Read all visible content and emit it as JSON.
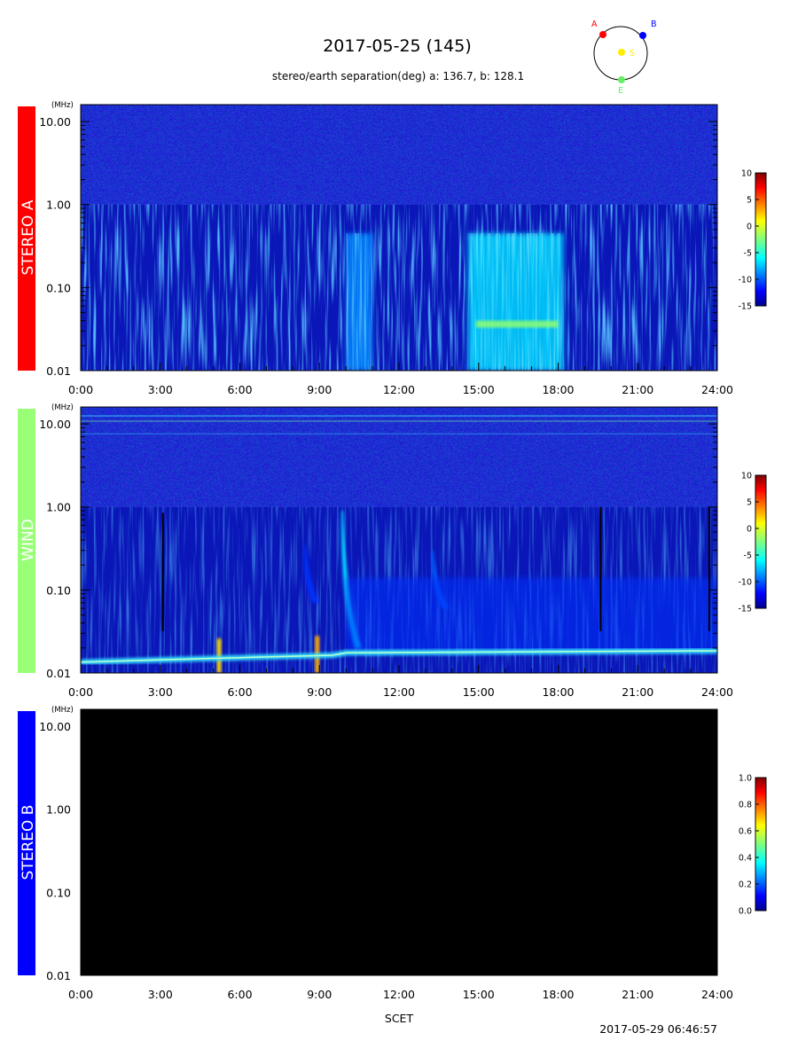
{
  "title": "2017-05-25 (145)",
  "subtitle": "stereo/earth separation(deg) a: 136.7, b: 128.1",
  "footer_xlabel": "SCET",
  "footer_timestamp": "2017-05-29 06:46:57",
  "orbit": {
    "labels": {
      "a": "A",
      "b": "B",
      "s": "S",
      "e": "E"
    },
    "colors": {
      "a": "#ff0000",
      "b": "#0000ff",
      "s": "#ffee00",
      "e": "#66ee66",
      "ring": "#000000"
    }
  },
  "chart_data": [
    {
      "type": "heatmap",
      "panel": "STEREO A",
      "side_label": "STEREO A",
      "side_color": "#ff0000",
      "unit_label": "(MHz)",
      "y_scale": "log",
      "ylim": [
        0.01,
        16
      ],
      "yticks": [
        {
          "value": 10,
          "label": "10.00"
        },
        {
          "value": 1,
          "label": "1.00"
        },
        {
          "value": 0.1,
          "label": "0.10"
        },
        {
          "value": 0.01,
          "label": "0.01"
        }
      ],
      "xlim": [
        0,
        24
      ],
      "xticks": [
        "0:00",
        "3:00",
        "6:00",
        "9:00",
        "12:00",
        "15:00",
        "18:00",
        "21:00",
        "24:00"
      ],
      "colorbar": {
        "min": -15,
        "max": 10,
        "ticks": [
          "10",
          "5",
          "0",
          "-5",
          "-10",
          "-15"
        ],
        "colormap": "jet"
      },
      "background": "dark-blue noise (low-frequency band 0.01-1 MHz, high-frequency band 1-16 MHz)",
      "features": [
        {
          "kind": "enhancement",
          "t_start": 10.0,
          "t_end": 11.0,
          "f_low": 0.01,
          "f_high": 0.45,
          "level": -9
        },
        {
          "kind": "enhancement",
          "t_start": 14.6,
          "t_end": 18.2,
          "f_low": 0.01,
          "f_high": 0.45,
          "level": -7
        },
        {
          "kind": "band",
          "t_start": 14.9,
          "t_end": 18.0,
          "f_low": 0.033,
          "f_high": 0.04,
          "level": -2
        }
      ]
    },
    {
      "type": "heatmap",
      "panel": "WIND",
      "side_label": "WIND",
      "side_color": "#99ff77",
      "unit_label": "(MHz)",
      "y_scale": "log",
      "ylim": [
        0.01,
        16
      ],
      "yticks": [
        {
          "value": 10,
          "label": "10.00"
        },
        {
          "value": 1,
          "label": "1.00"
        },
        {
          "value": 0.1,
          "label": "0.10"
        },
        {
          "value": 0.01,
          "label": "0.01"
        }
      ],
      "xlim": [
        0,
        24
      ],
      "xticks": [
        "0:00",
        "3:00",
        "6:00",
        "9:00",
        "12:00",
        "15:00",
        "18:00",
        "21:00",
        "24:00"
      ],
      "colorbar": {
        "min": -15,
        "max": 10,
        "ticks": [
          "10",
          "5",
          "0",
          "-5",
          "-10",
          "-15"
        ],
        "colormap": "jet"
      },
      "background": "dark-blue noise; plasma line near 0.014-0.018 MHz",
      "features": [
        {
          "kind": "type-III burst",
          "t_start": 9.9,
          "t_end": 10.6,
          "f_low": 0.02,
          "f_high": 0.9,
          "level": -7
        },
        {
          "kind": "type-III burst",
          "t_start": 13.3,
          "t_end": 13.9,
          "f_low": 0.06,
          "f_high": 0.3,
          "level": -10
        },
        {
          "kind": "type-III burst",
          "t_start": 8.5,
          "t_end": 9.0,
          "f_low": 0.07,
          "f_high": 0.35,
          "level": -11
        },
        {
          "kind": "diffuse emission",
          "t_start": 10.0,
          "t_end": 24.0,
          "f_low": 0.018,
          "f_high": 0.14,
          "level": -11
        },
        {
          "kind": "data gap",
          "t": 3.1,
          "f_low": 0.032,
          "f_high": 0.85
        },
        {
          "kind": "data gap",
          "t": 19.6,
          "f_low": 0.032,
          "f_high": 1.0
        },
        {
          "kind": "data gap",
          "t": 23.7,
          "f_low": 0.032,
          "f_high": 1.0
        },
        {
          "kind": "spike",
          "t": 5.2,
          "f_low": 0.01,
          "f_high": 0.026,
          "level": 2
        },
        {
          "kind": "spike",
          "t": 8.9,
          "f_low": 0.01,
          "f_high": 0.028,
          "level": 3
        }
      ]
    },
    {
      "type": "heatmap",
      "panel": "STEREO B",
      "side_label": "STEREO B",
      "side_color": "#0000ff",
      "unit_label": "(MHz)",
      "y_scale": "log",
      "ylim": [
        0.01,
        16
      ],
      "yticks": [
        {
          "value": 10,
          "label": "10.00"
        },
        {
          "value": 1,
          "label": "1.00"
        },
        {
          "value": 0.1,
          "label": "0.10"
        },
        {
          "value": 0.01,
          "label": "0.01"
        }
      ],
      "xlim": [
        0,
        24
      ],
      "xticks": [
        "0:00",
        "3:00",
        "6:00",
        "9:00",
        "12:00",
        "15:00",
        "18:00",
        "21:00",
        "24:00"
      ],
      "colorbar": {
        "min": 0.0,
        "max": 1.0,
        "ticks": [
          "1.0",
          "0.8",
          "0.6",
          "0.4",
          "0.2",
          "0.0"
        ],
        "colormap": "jet"
      },
      "background": "black (no data)",
      "features": []
    }
  ]
}
